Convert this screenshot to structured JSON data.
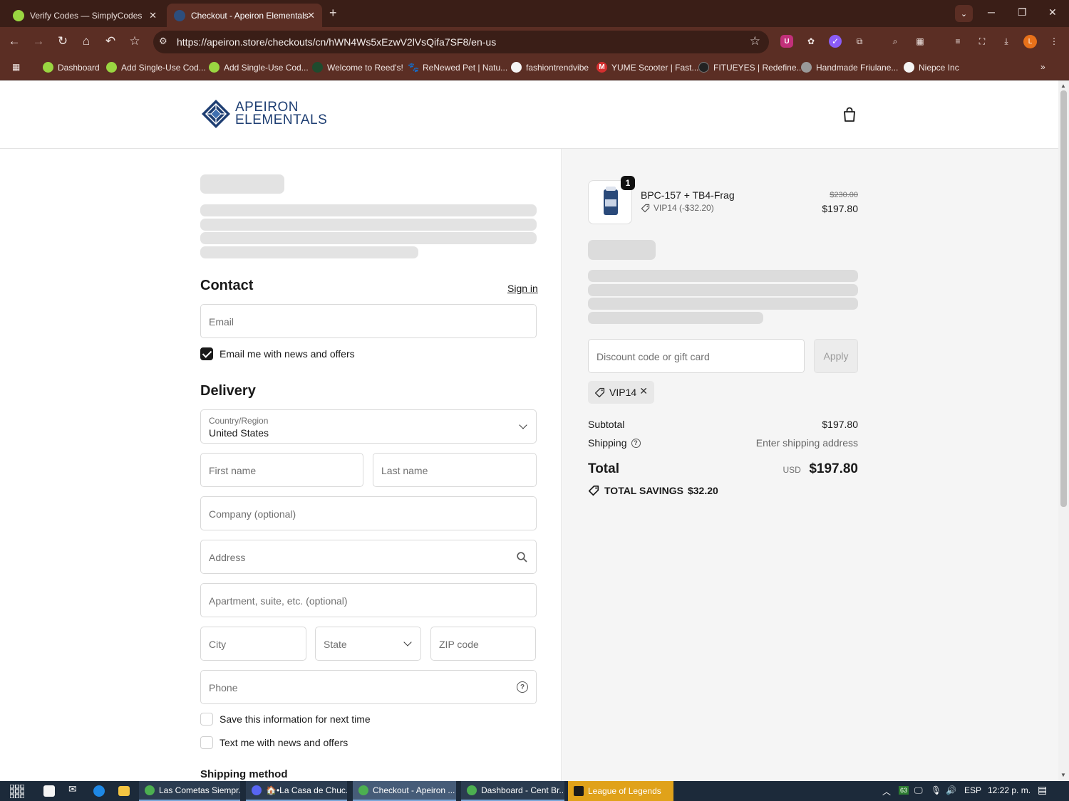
{
  "browser": {
    "tabs": [
      {
        "title": "Verify Codes — SimplyCodes",
        "active": false
      },
      {
        "title": "Checkout - Apeiron Elementals",
        "active": true
      }
    ],
    "url": "https://apeiron.store/checkouts/cn/hWN4Ws5xEzwV2lVsQifa7SF8/en-us",
    "profile_initial": "L",
    "bookmarks": [
      {
        "label": "Dashboard",
        "icon": "simplycodes-icon"
      },
      {
        "label": "Add Single-Use Cod...",
        "icon": "simplycodes-icon"
      },
      {
        "label": "Add Single-Use Cod...",
        "icon": "simplycodes-icon"
      },
      {
        "label": "Welcome to Reed's!",
        "icon": "reeds-icon"
      },
      {
        "label": "ReNewed Pet | Natu...",
        "icon": "paw-icon"
      },
      {
        "label": "fashiontrendvibe",
        "icon": "page-icon"
      },
      {
        "label": "YUME Scooter | Fast...",
        "icon": "yume-icon"
      },
      {
        "label": "FITUEYES | Redefine...",
        "icon": "fitueyes-icon"
      },
      {
        "label": "Handmade Friulane...",
        "icon": "craft-icon"
      },
      {
        "label": "Niepce Inc",
        "icon": "page-icon"
      }
    ]
  },
  "store": {
    "logo_line1": "APEIRON",
    "logo_line2": "ELEMENTALS",
    "accent_color": "#1f3f73"
  },
  "checkout": {
    "contact": {
      "title": "Contact",
      "sign_in": "Sign in",
      "email_placeholder": "Email",
      "newsletter_label": "Email me with news and offers",
      "newsletter_checked": true
    },
    "delivery": {
      "title": "Delivery",
      "country_label": "Country/Region",
      "country_value": "United States",
      "first_name": "First name",
      "last_name": "Last name",
      "company": "Company (optional)",
      "address": "Address",
      "apartment": "Apartment, suite, etc. (optional)",
      "city": "City",
      "state": "State",
      "zip": "ZIP code",
      "phone": "Phone",
      "save_info": "Save this information for next time",
      "text_me": "Text me with news and offers"
    },
    "shipping_method_title": "Shipping method"
  },
  "summary": {
    "item": {
      "quantity": "1",
      "name": "BPC-157 + TB4-Frag",
      "discount": "VIP14 (-$32.20)",
      "original_price": "$230.00",
      "price": "$197.80"
    },
    "discount_placeholder": "Discount code or gift card",
    "apply": "Apply",
    "applied_code": "VIP14",
    "subtotal_label": "Subtotal",
    "subtotal_value": "$197.80",
    "shipping_label": "Shipping",
    "shipping_value": "Enter shipping address",
    "total_label": "Total",
    "currency": "USD",
    "total_value": "$197.80",
    "savings_label": "TOTAL SAVINGS",
    "savings_value": "$32.20"
  },
  "taskbar": {
    "items": [
      {
        "label": "Las Cometas Siempr..."
      },
      {
        "label": "🏠•La Casa de Chuc..."
      },
      {
        "label": "Checkout - Apeiron ..."
      },
      {
        "label": "Dashboard - Cent Br..."
      },
      {
        "label": "League of Legends"
      }
    ],
    "battery": "63",
    "language": "ESP",
    "clock": "12:22 p. m."
  }
}
